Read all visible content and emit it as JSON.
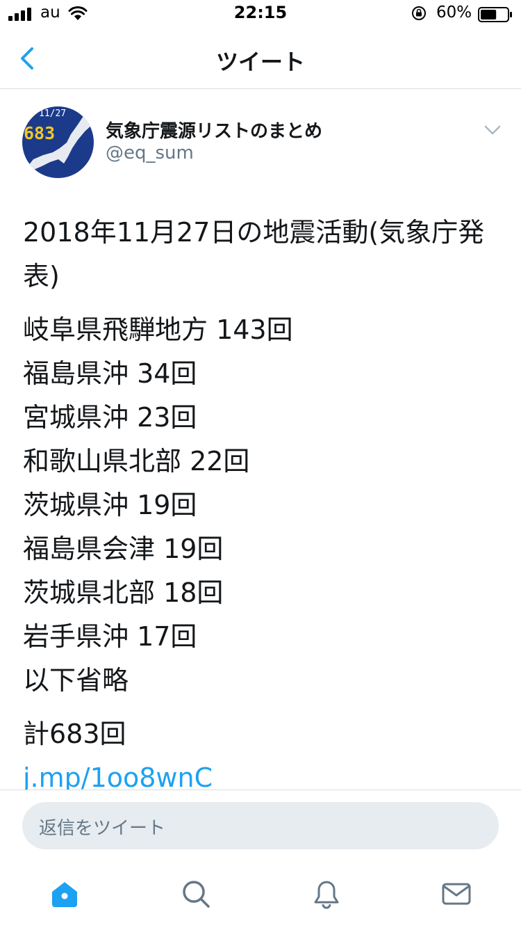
{
  "status_bar": {
    "carrier": "au",
    "time": "22:15",
    "battery": "60%",
    "battery_level": 0.6
  },
  "nav": {
    "title": "ツイート"
  },
  "tweet": {
    "author_name": "気象庁震源リストのまとめ",
    "author_handle": "@eq_sum",
    "avatar": {
      "date": "11/27",
      "count": "683"
    },
    "headline": "2018年11月27日の地震活動(気象庁発表)",
    "regions": [
      "岐阜県飛騨地方 143回",
      "福島県沖 34回",
      "宮城県沖 23回",
      "和歌山県北部 22回",
      "茨城県沖 19回",
      "福島県会津 19回",
      "茨城県北部 18回",
      "岩手県沖 17回",
      "以下省略"
    ],
    "total": "計683回",
    "link": "j.mp/1oo8wnC"
  },
  "reply": {
    "placeholder": "返信をツイート"
  },
  "tabs": [
    {
      "icon": "home-icon"
    },
    {
      "icon": "search-icon"
    },
    {
      "icon": "notifications-icon"
    },
    {
      "icon": "messages-icon"
    }
  ],
  "colors": {
    "accent": "#1da1f2",
    "text": "#14171a",
    "secondary": "#657786",
    "avatar_bg": "#1b3b8a",
    "avatar_digits": "#f3c623"
  }
}
